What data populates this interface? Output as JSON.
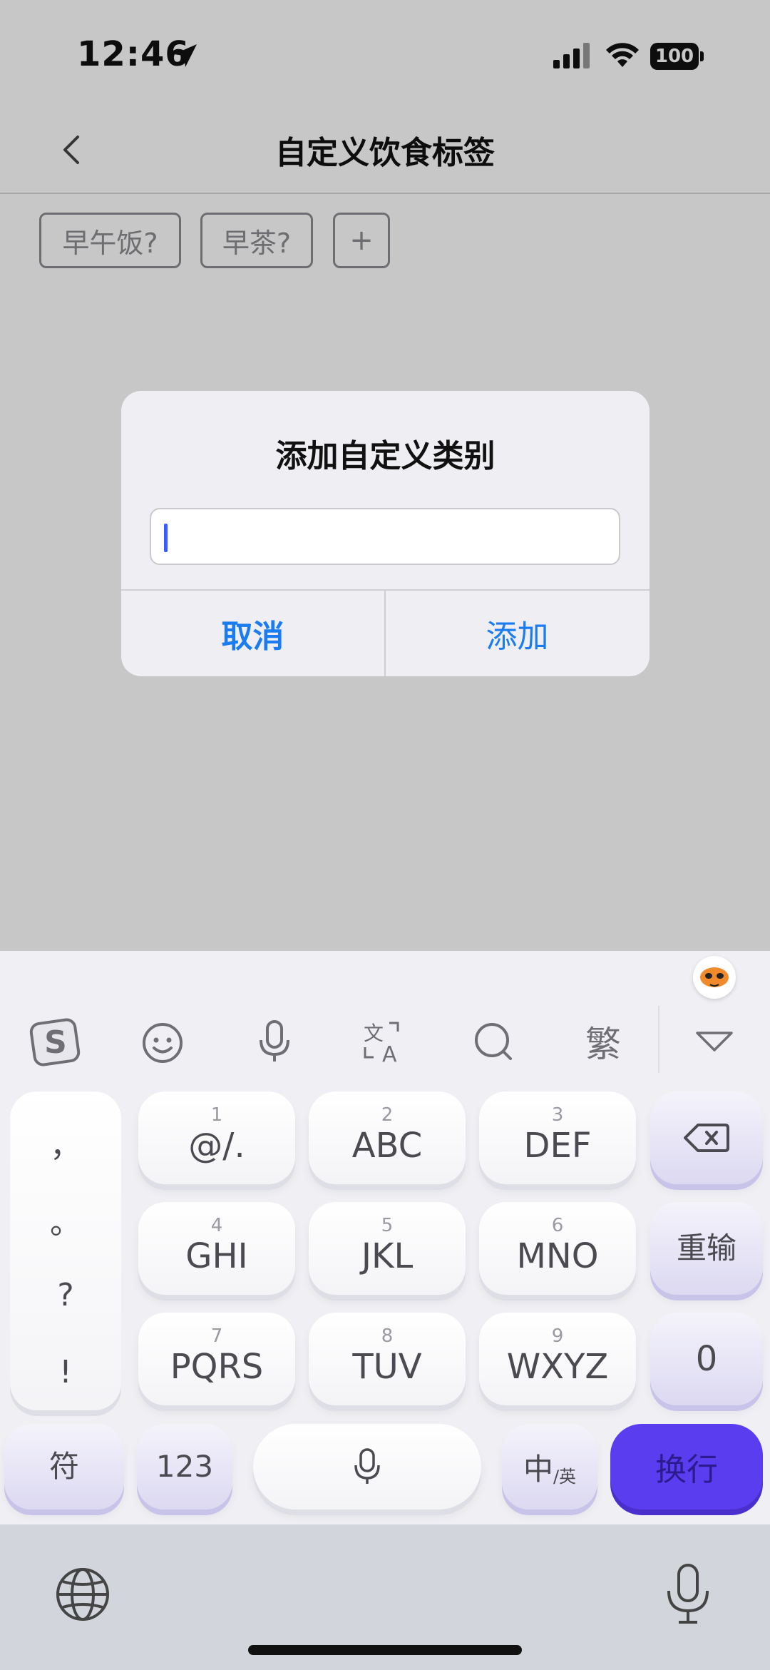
{
  "status": {
    "time": "12:46",
    "battery": "100"
  },
  "nav": {
    "title": "自定义饮食标签"
  },
  "chips": [
    "早午饭?",
    "早茶?",
    "+"
  ],
  "dialog": {
    "title": "添加自定义类别",
    "input_value": "",
    "cancel_label": "取消",
    "add_label": "添加"
  },
  "keyboard": {
    "toolbar": {
      "fan_label": "繁"
    },
    "punctuation": [
      "，",
      "。",
      "?",
      "!"
    ],
    "keys": [
      {
        "num": "1",
        "label": "@/."
      },
      {
        "num": "2",
        "label": "ABC"
      },
      {
        "num": "3",
        "label": "DEF"
      },
      {
        "num": "4",
        "label": "GHI"
      },
      {
        "num": "5",
        "label": "JKL"
      },
      {
        "num": "6",
        "label": "MNO"
      },
      {
        "num": "7",
        "label": "PQRS"
      },
      {
        "num": "8",
        "label": "TUV"
      },
      {
        "num": "9",
        "label": "WXYZ"
      }
    ],
    "reinput_label": "重输",
    "zero_label": "0",
    "symbols_label": "符",
    "numbers_label": "123",
    "lang_main": "中",
    "lang_sub": "/英",
    "enter_label": "换行"
  },
  "colors": {
    "accent": "#1a7cf0",
    "enter": "#5b3df0"
  }
}
